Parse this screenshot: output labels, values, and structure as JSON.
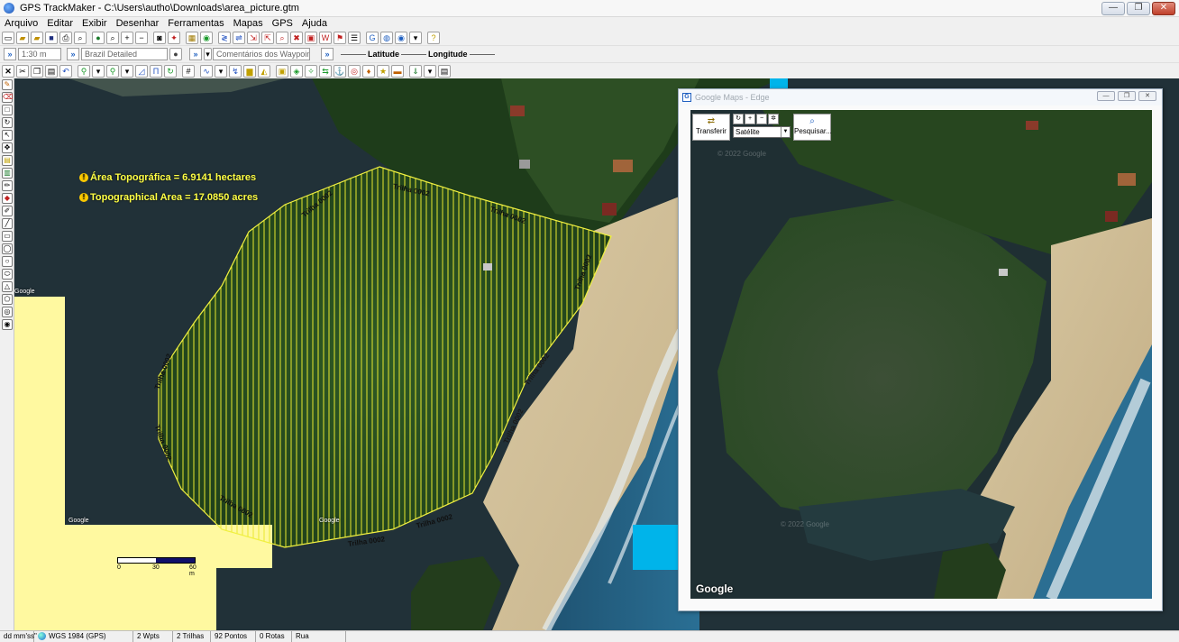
{
  "window": {
    "title": "GPS TrackMaker - C:\\Users\\autho\\Downloads\\area_picture.gtm",
    "minimize": "—",
    "maximize": "❐",
    "close": "✕"
  },
  "menu": [
    "Arquivo",
    "Editar",
    "Exibir",
    "Desenhar",
    "Ferramentas",
    "Mapas",
    "GPS",
    "Ajuda"
  ],
  "toolbar2": {
    "scale_value": "1:30 m",
    "map_name": "Brazil Detailed",
    "waypoint_comments_placeholder": "Comentários dos Waypoints",
    "latitude_label": "Latitude",
    "longitude_label": "Longitude",
    "arrow": "»"
  },
  "map": {
    "area_hectares": "Área Topográfica = 6.9141 hectares",
    "area_acres": "Topographical Area = 17.0850 acres",
    "trail_name": "Trilha 0002",
    "google_credit": "Google",
    "scale_labels": [
      "0",
      "30",
      "60 m"
    ],
    "colors": {
      "hatch": "#e8e830",
      "label": "#ffff44",
      "tile_fill": "#fff9a0",
      "sky": "#00b4ea"
    }
  },
  "google_maps_window": {
    "title": "Google Maps - Edge",
    "transfer_label": "Transferir",
    "map_type": "Satélite",
    "search_label": "Pesquisar...",
    "google_logo": "Google",
    "watermark": "© 2022 Google",
    "window_controls": [
      "—",
      "❐",
      "✕"
    ]
  },
  "statusbar": {
    "format": "dd mm'ss\"",
    "datum": "WGS 1984 (GPS)",
    "waypoints": "2 Wpts",
    "tracks": "2 Trilhas",
    "points": "92 Pontos",
    "routes": "0 Rotas",
    "street": "Rua"
  }
}
